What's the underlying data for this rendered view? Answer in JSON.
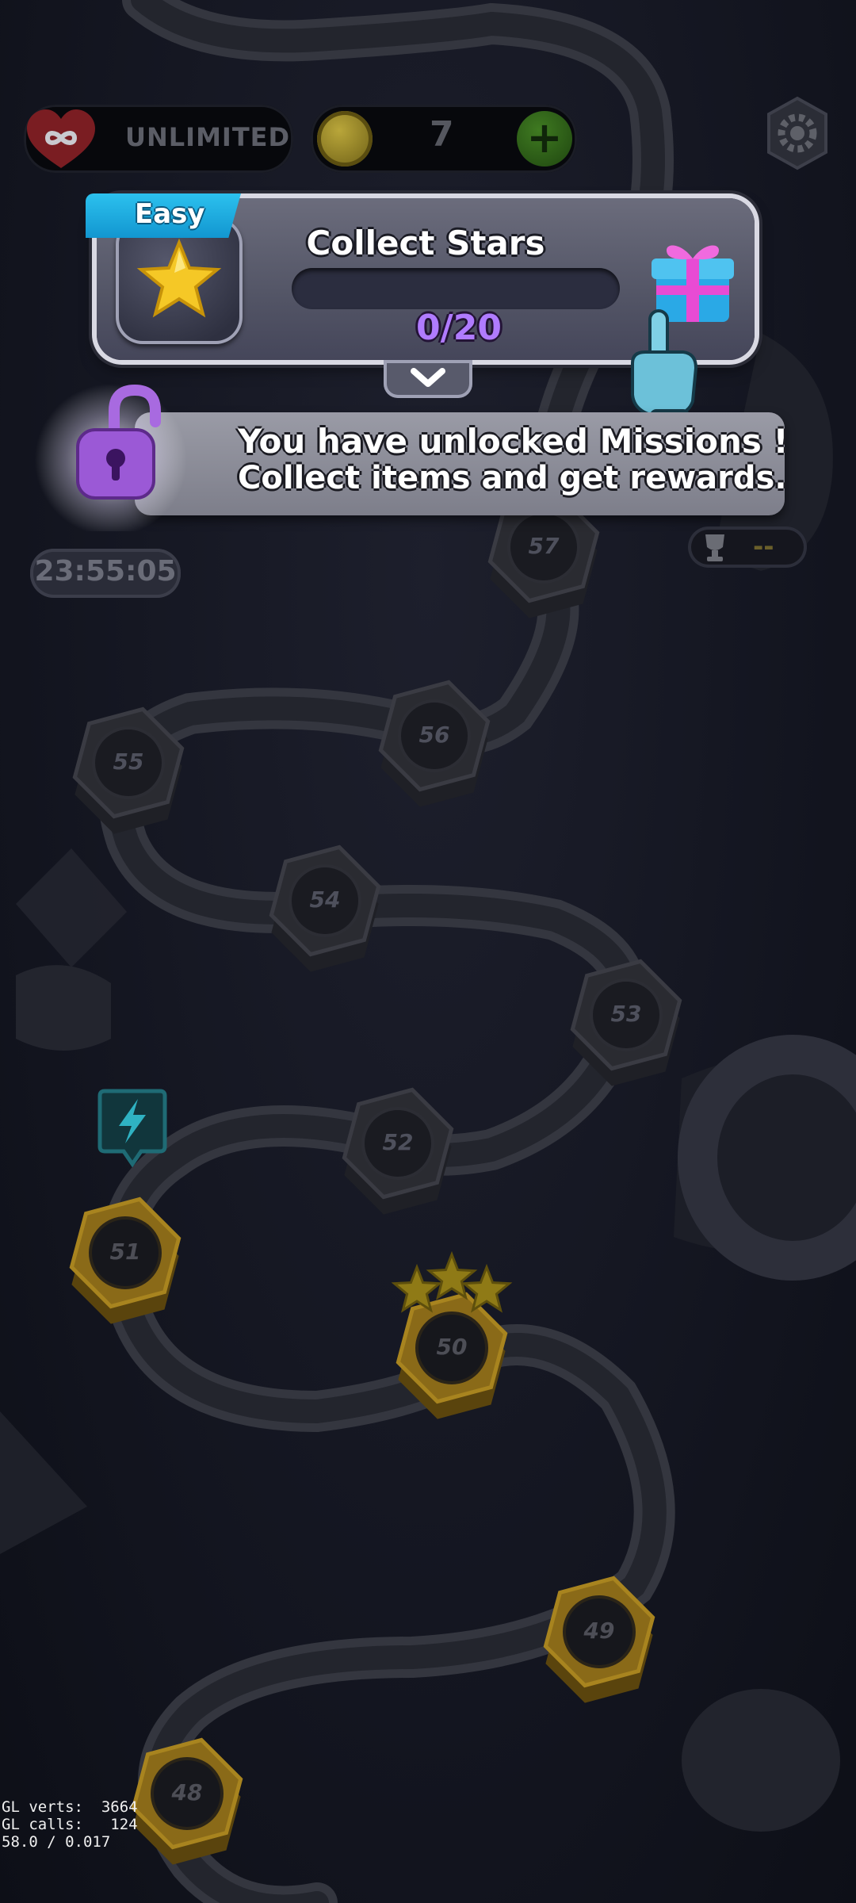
{
  "hud": {
    "lives_text": "UNLIMITED",
    "coin_count": "7",
    "plus_label": "+"
  },
  "mission": {
    "difficulty": "Easy",
    "title": "Collect Stars",
    "progress_text": "0/20",
    "progress_fraction": 0
  },
  "unlock": {
    "line1": "You have unlocked Missions !",
    "line2": "Collect items and get rewards."
  },
  "event_timer": "23:55:05",
  "trophy_text": "--",
  "levels": [
    {
      "number": "57",
      "state": "locked"
    },
    {
      "number": "56",
      "state": "locked"
    },
    {
      "number": "55",
      "state": "locked"
    },
    {
      "number": "54",
      "state": "locked"
    },
    {
      "number": "53",
      "state": "locked"
    },
    {
      "number": "52",
      "state": "locked"
    },
    {
      "number": "51",
      "state": "completed"
    },
    {
      "number": "50",
      "state": "completed",
      "stars": 3
    },
    {
      "number": "49",
      "state": "completed"
    },
    {
      "number": "48",
      "state": "completed"
    }
  ],
  "debug": {
    "line1": "GL verts:  3664",
    "line2": "GL calls:   124",
    "line3": "58.0 / 0.017"
  },
  "colors": {
    "accent_easy": "#1aa9e0",
    "progress_text": "#b07bff",
    "completed_node": "#8a6a18",
    "locked_node": "#2a2b31"
  }
}
